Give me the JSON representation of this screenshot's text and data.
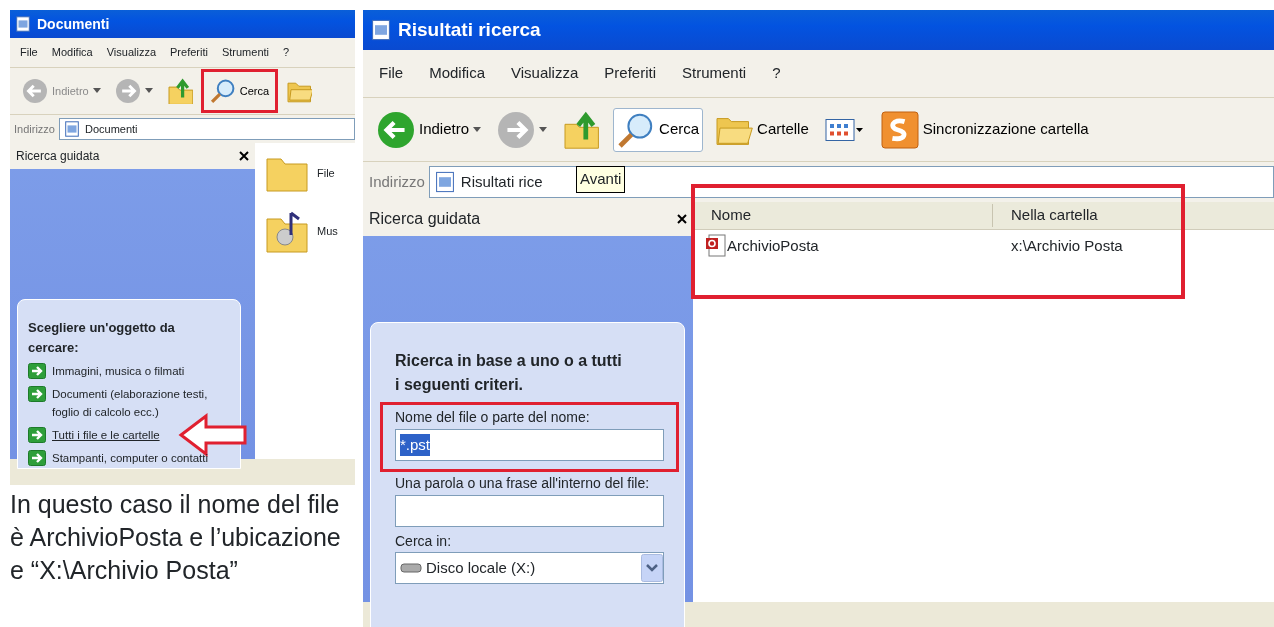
{
  "left_window": {
    "title": "Documenti",
    "menu": [
      "File",
      "Modifica",
      "Visualizza",
      "Preferiti",
      "Strumenti",
      "?"
    ],
    "toolbar": [
      {
        "kind": "back",
        "label": "Indietro",
        "disabled": true
      },
      {
        "kind": "forward",
        "disabled": true
      },
      {
        "kind": "up"
      },
      {
        "kind": "search",
        "label": "Cerca",
        "pressed": false,
        "highlighted": true
      },
      {
        "kind": "folders"
      }
    ],
    "address": {
      "label": "Indirizzo",
      "value": "Documenti"
    },
    "pane": {
      "title": "Ricerca guidata",
      "heading": "Scegliere un'oggetto da cercare:",
      "options": [
        {
          "label": "Immagini, musica o filmati",
          "hovered": false,
          "pointed": false
        },
        {
          "label": "Documenti (elaborazione testi, foglio di calcolo ecc.)",
          "hovered": false,
          "pointed": false
        },
        {
          "label": "Tutti i file e le cartelle",
          "hovered": true,
          "pointed": true
        },
        {
          "label": "Stampanti, computer o contatti",
          "hovered": false,
          "pointed": false
        }
      ]
    },
    "items": [
      {
        "kind": "folder",
        "name": "File"
      },
      {
        "kind": "music",
        "name": "Mus"
      }
    ]
  },
  "caption": "In questo caso il nome del file è ArchivioPosta e l’ubicazione e “X:\\Archivio Posta”",
  "right_window": {
    "title": "Risultati ricerca",
    "menu": [
      "File",
      "Modifica",
      "Visualizza",
      "Preferiti",
      "Strumenti",
      "?"
    ],
    "toolbar": [
      {
        "kind": "back",
        "label": "Indietro",
        "disabled": false
      },
      {
        "kind": "forward",
        "disabled": true
      },
      {
        "kind": "up"
      },
      {
        "kind": "search",
        "label": "Cerca",
        "pressed": true,
        "highlighted": false
      },
      {
        "kind": "folders",
        "label": "Cartelle"
      },
      {
        "kind": "views"
      },
      {
        "kind": "sync",
        "label": "Sincronizzazione cartella"
      }
    ],
    "address": {
      "label": "Indirizzo",
      "value": "Risultati rice"
    },
    "tooltip": "Avanti",
    "pane": {
      "title": "Ricerca guidata",
      "heading": "Ricerca in base a uno o a tutti i seguenti criteri.",
      "fields": [
        {
          "kind": "text",
          "label": "Nome del file o parte del nome:",
          "value": "*.pst",
          "value_selected": true,
          "highlighted": true
        },
        {
          "kind": "text",
          "label": "Una parola o una frase all'interno del file:",
          "highlighted": false
        },
        {
          "kind": "select",
          "label": "Cerca in:",
          "value": "Disco locale (X:)",
          "highlighted": false
        }
      ]
    },
    "results": {
      "highlighted": true,
      "columns": [
        "Nome",
        "Nella cartella"
      ],
      "rows": [
        {
          "name": "ArchivioPosta",
          "folder": "x:\\Archivio Posta"
        }
      ]
    }
  }
}
